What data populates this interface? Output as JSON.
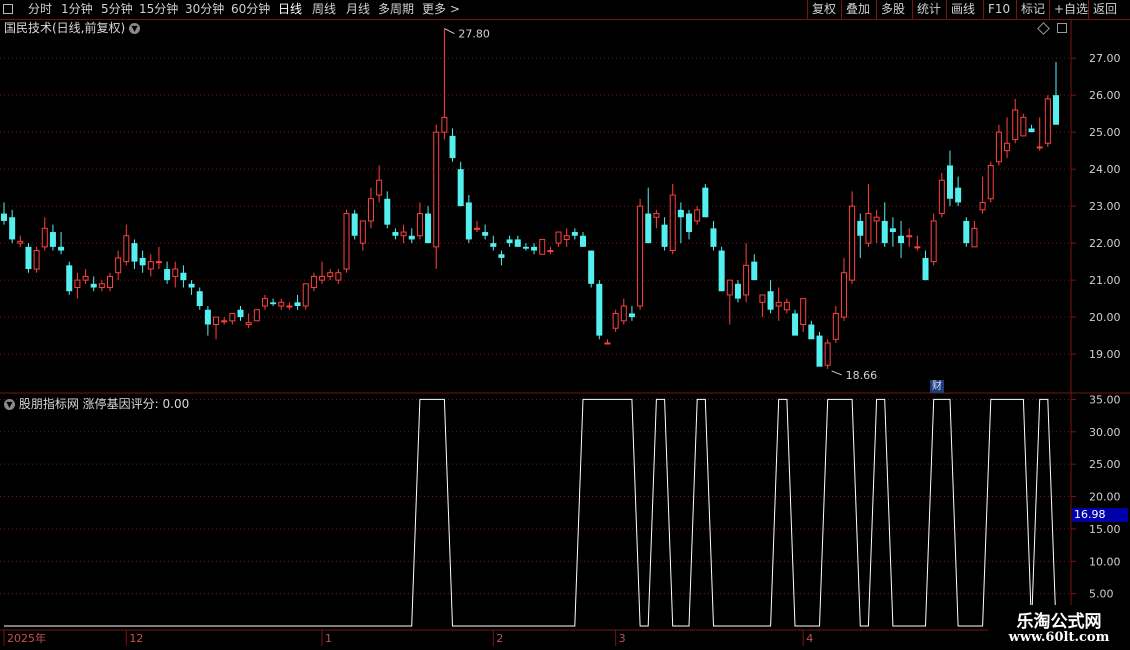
{
  "toolbar": {
    "left": [
      "分时",
      "1分钟",
      "5分钟",
      "15分钟",
      "30分钟",
      "60分钟",
      "日线",
      "周线",
      "月线",
      "多周期",
      "更多 >"
    ],
    "active": "日线",
    "right": [
      "复权",
      "叠加",
      "多股",
      "统计",
      "画线",
      "F10",
      "标记",
      "+自选",
      "返回"
    ]
  },
  "main_pane": {
    "title": "国民技术(日线,前复权)",
    "high_label": "27.80",
    "low_label": "18.66",
    "fin_badge": "财",
    "y_ticks": [
      "27.00",
      "26.00",
      "25.00",
      "24.00",
      "23.00",
      "22.00",
      "21.00",
      "20.00",
      "19.00"
    ]
  },
  "indicator_pane": {
    "title": "股朋指标网 涨停基因评分: 0.00",
    "y_ticks": [
      "35.00",
      "30.00",
      "25.00",
      "20.00",
      "15.00",
      "10.00",
      "5.00"
    ],
    "current_value": "16.98"
  },
  "x_axis": {
    "labels": [
      "2025年",
      "12",
      "1",
      "2",
      "3",
      "4"
    ]
  },
  "watermark": {
    "line1": "乐淘公式网",
    "line2": "www.60lt.com"
  },
  "colors": {
    "up": "#ff4040",
    "down": "#54f0f0",
    "grid": "#7a1414",
    "line": "#ffffff"
  },
  "chart_data": [
    {
      "type": "candlestick",
      "ylim": [
        18.3,
        27.6
      ],
      "ohlc": [
        [
          22.8,
          23.1,
          22.5,
          22.6
        ],
        [
          22.7,
          22.9,
          22.0,
          22.1
        ],
        [
          22.0,
          22.2,
          21.9,
          22.05
        ],
        [
          21.9,
          22.0,
          21.2,
          21.3
        ],
        [
          21.3,
          21.9,
          21.2,
          21.8
        ],
        [
          21.9,
          22.7,
          21.8,
          22.4
        ],
        [
          22.3,
          22.5,
          21.8,
          21.9
        ],
        [
          21.9,
          22.3,
          21.7,
          21.8
        ],
        [
          21.4,
          21.5,
          20.6,
          20.7
        ],
        [
          20.8,
          21.2,
          20.5,
          21.0
        ],
        [
          21.0,
          21.3,
          20.9,
          21.1
        ],
        [
          20.9,
          21.1,
          20.7,
          20.8
        ],
        [
          20.8,
          21.0,
          20.7,
          20.9
        ],
        [
          20.8,
          21.2,
          20.7,
          21.1
        ],
        [
          21.2,
          21.8,
          21.0,
          21.6
        ],
        [
          21.5,
          22.5,
          21.4,
          22.2
        ],
        [
          22.0,
          22.1,
          21.3,
          21.5
        ],
        [
          21.6,
          21.8,
          21.2,
          21.4
        ],
        [
          21.3,
          21.7,
          21.1,
          21.5
        ],
        [
          21.5,
          21.9,
          21.3,
          21.5
        ],
        [
          21.3,
          21.5,
          20.9,
          21.0
        ],
        [
          21.1,
          21.5,
          20.8,
          21.3
        ],
        [
          21.2,
          21.4,
          20.8,
          21.0
        ],
        [
          20.9,
          21.0,
          20.6,
          20.8
        ],
        [
          20.7,
          20.8,
          20.2,
          20.3
        ],
        [
          20.2,
          20.3,
          19.5,
          19.8
        ],
        [
          19.8,
          20.0,
          19.4,
          20.0
        ],
        [
          19.9,
          20.0,
          19.8,
          19.9
        ],
        [
          19.9,
          20.1,
          19.8,
          20.1
        ],
        [
          20.2,
          20.3,
          19.9,
          20.0
        ],
        [
          19.8,
          20.1,
          19.7,
          19.85
        ],
        [
          19.9,
          20.2,
          19.9,
          20.2
        ],
        [
          20.3,
          20.6,
          20.2,
          20.5
        ],
        [
          20.4,
          20.5,
          20.3,
          20.35
        ],
        [
          20.3,
          20.5,
          20.2,
          20.4
        ],
        [
          20.3,
          20.4,
          20.2,
          20.3
        ],
        [
          20.4,
          20.6,
          20.2,
          20.3
        ],
        [
          20.3,
          20.9,
          20.2,
          20.9
        ],
        [
          20.8,
          21.2,
          20.7,
          21.1
        ],
        [
          21.0,
          21.5,
          20.9,
          21.1
        ],
        [
          21.1,
          21.3,
          21.0,
          21.2
        ],
        [
          21.0,
          21.3,
          20.9,
          21.2
        ],
        [
          21.3,
          22.9,
          21.2,
          22.8
        ],
        [
          22.8,
          22.9,
          22.1,
          22.2
        ],
        [
          22.0,
          22.6,
          21.8,
          22.6
        ],
        [
          22.6,
          23.5,
          22.4,
          23.2
        ],
        [
          23.3,
          24.1,
          23.1,
          23.7
        ],
        [
          23.2,
          23.4,
          22.4,
          22.5
        ],
        [
          22.3,
          22.4,
          22.1,
          22.2
        ],
        [
          22.2,
          22.5,
          22.0,
          22.3
        ],
        [
          22.2,
          22.4,
          22.0,
          22.1
        ],
        [
          22.2,
          23.1,
          22.1,
          22.8
        ],
        [
          22.8,
          23.0,
          22.0,
          22.0
        ],
        [
          21.9,
          25.2,
          21.3,
          25.0
        ],
        [
          25.0,
          27.8,
          24.8,
          25.4
        ],
        [
          24.9,
          25.1,
          24.2,
          24.3
        ],
        [
          24.0,
          24.2,
          23.0,
          23.0
        ],
        [
          23.1,
          23.3,
          22.0,
          22.1
        ],
        [
          22.4,
          22.6,
          22.3,
          22.4
        ],
        [
          22.3,
          22.5,
          22.1,
          22.2
        ],
        [
          22.0,
          22.2,
          21.8,
          21.9
        ],
        [
          21.7,
          21.8,
          21.4,
          21.6
        ],
        [
          22.1,
          22.2,
          21.9,
          22.0
        ],
        [
          22.1,
          22.2,
          21.9,
          21.9
        ],
        [
          21.9,
          22.0,
          21.8,
          21.85
        ],
        [
          21.9,
          22.0,
          21.7,
          21.8
        ],
        [
          21.7,
          22.1,
          21.7,
          22.1
        ],
        [
          21.8,
          21.9,
          21.7,
          21.8
        ],
        [
          22.0,
          22.3,
          21.9,
          22.3
        ],
        [
          22.1,
          22.4,
          21.9,
          22.2
        ],
        [
          22.3,
          22.4,
          22.1,
          22.2
        ],
        [
          22.2,
          22.3,
          21.9,
          21.9
        ],
        [
          21.8,
          21.8,
          20.8,
          20.9
        ],
        [
          20.9,
          21.0,
          19.4,
          19.5
        ],
        [
          19.3,
          19.4,
          19.3,
          19.3
        ],
        [
          19.7,
          20.2,
          19.6,
          20.1
        ],
        [
          19.9,
          20.5,
          19.8,
          20.3
        ],
        [
          20.1,
          20.3,
          19.9,
          20.0
        ],
        [
          20.3,
          23.2,
          20.2,
          23.0
        ],
        [
          22.8,
          23.5,
          22.1,
          22.0
        ],
        [
          22.7,
          22.9,
          22.4,
          22.8
        ],
        [
          22.5,
          22.7,
          21.8,
          21.9
        ],
        [
          21.8,
          23.6,
          21.7,
          23.3
        ],
        [
          22.9,
          23.1,
          22.0,
          22.7
        ],
        [
          22.8,
          22.9,
          22.1,
          22.3
        ],
        [
          22.6,
          23.0,
          22.5,
          22.9
        ],
        [
          23.5,
          23.6,
          22.7,
          22.7
        ],
        [
          22.4,
          22.6,
          21.8,
          21.9
        ],
        [
          21.8,
          21.9,
          20.7,
          20.7
        ],
        [
          20.6,
          20.8,
          19.8,
          21.0
        ],
        [
          20.9,
          21.0,
          20.4,
          20.5
        ],
        [
          20.6,
          22.0,
          20.4,
          21.4
        ],
        [
          21.5,
          21.7,
          21.0,
          21.0
        ],
        [
          20.4,
          20.6,
          20.0,
          20.6
        ],
        [
          20.7,
          21.0,
          20.1,
          20.2
        ],
        [
          20.3,
          20.8,
          19.9,
          20.4
        ],
        [
          20.2,
          20.5,
          20.1,
          20.4
        ],
        [
          20.1,
          20.2,
          19.6,
          19.5
        ],
        [
          19.8,
          20.5,
          19.6,
          20.5
        ],
        [
          19.8,
          19.9,
          19.5,
          19.4
        ],
        [
          19.5,
          19.6,
          18.9,
          18.66
        ],
        [
          18.7,
          19.4,
          18.6,
          19.3
        ],
        [
          19.4,
          20.3,
          19.3,
          20.1
        ],
        [
          20.0,
          21.6,
          19.9,
          21.2
        ],
        [
          21.0,
          23.4,
          20.9,
          23.0
        ],
        [
          22.6,
          22.8,
          21.6,
          22.2
        ],
        [
          22.0,
          23.6,
          21.9,
          22.8
        ],
        [
          22.6,
          22.9,
          22.0,
          22.7
        ],
        [
          22.6,
          23.1,
          21.9,
          22.0
        ],
        [
          22.4,
          22.7,
          21.9,
          22.3
        ],
        [
          22.2,
          22.6,
          21.6,
          22.0
        ],
        [
          22.2,
          22.4,
          21.9,
          22.2
        ],
        [
          21.9,
          22.2,
          21.8,
          21.9
        ],
        [
          21.6,
          21.8,
          21.0,
          21.0
        ],
        [
          21.5,
          22.8,
          21.4,
          22.6
        ],
        [
          22.8,
          23.9,
          22.7,
          23.7
        ],
        [
          24.1,
          24.5,
          23.0,
          23.2
        ],
        [
          23.5,
          23.8,
          23.0,
          23.1
        ],
        [
          22.6,
          22.7,
          21.9,
          22.0
        ],
        [
          21.9,
          22.6,
          21.9,
          22.4
        ],
        [
          22.9,
          23.8,
          22.8,
          23.1
        ],
        [
          23.2,
          24.2,
          23.1,
          24.1
        ],
        [
          24.2,
          25.2,
          24.1,
          25.0
        ],
        [
          24.5,
          25.4,
          24.3,
          24.7
        ],
        [
          24.8,
          25.9,
          24.7,
          25.6
        ],
        [
          24.9,
          25.5,
          24.9,
          25.4
        ],
        [
          25.1,
          25.2,
          25.0,
          25.0
        ],
        [
          24.6,
          25.4,
          24.5,
          24.6
        ],
        [
          24.7,
          26.0,
          24.6,
          25.9
        ],
        [
          26.0,
          26.9,
          25.6,
          25.2
        ]
      ]
    },
    {
      "type": "line",
      "name": "涨停基因评分",
      "ylim": [
        0,
        38
      ],
      "spikes": [
        [
          51,
          54
        ],
        [
          71,
          73
        ],
        [
          74,
          77
        ],
        [
          80,
          81
        ],
        [
          85,
          86
        ],
        [
          95,
          96
        ],
        [
          101,
          104
        ],
        [
          107,
          108
        ],
        [
          114,
          116
        ],
        [
          121,
          123
        ],
        [
          124,
          125
        ],
        [
          127,
          128
        ]
      ],
      "spike_value": 35.0,
      "base_value": 0.0
    }
  ]
}
